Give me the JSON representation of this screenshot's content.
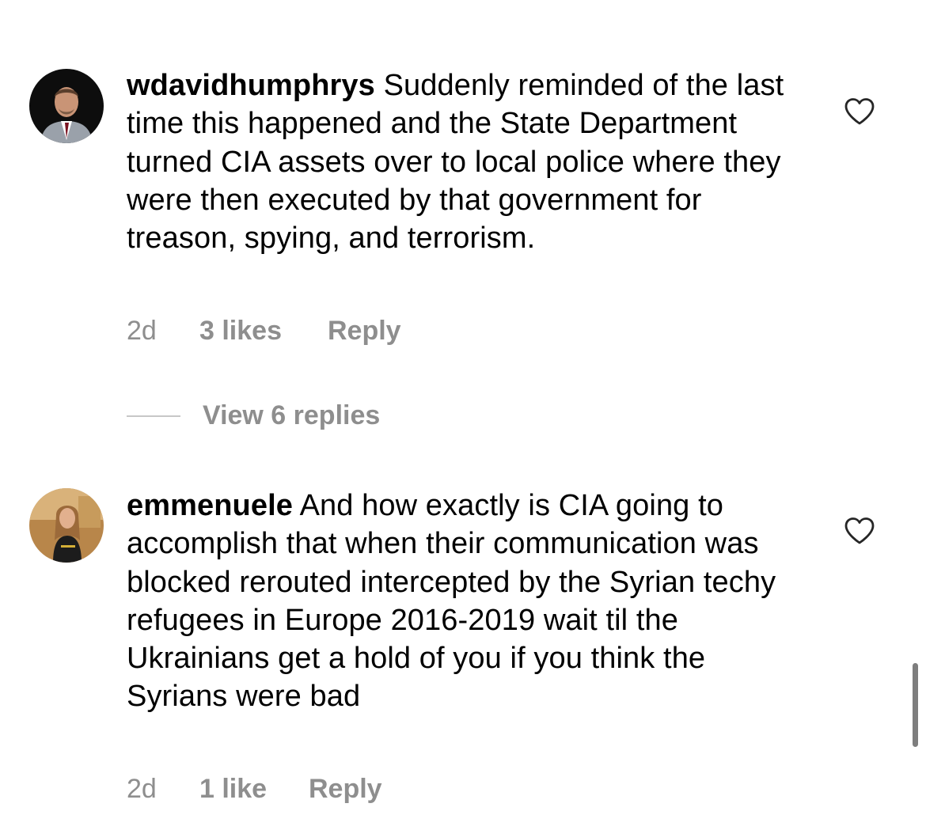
{
  "comments": [
    {
      "username": "wdavidhumphrys",
      "text": "Suddenly reminded of the last time this happened and the State Department turned CIA assets over to local police where they were then executed by that government for treason, spying, and terrorism.",
      "time": "2d",
      "likes": "3 likes",
      "reply": "Reply",
      "like_icon": "heart-outline-icon"
    },
    {
      "username": "emmenuele",
      "text": "And how exactly is CIA going to accomplish that when their communication was blocked rerouted intercepted by the Syrian techy refugees in Europe 2016-2019 wait til the Ukrainians get a hold of you if you think the Syrians were bad",
      "time": "2d",
      "likes": "1 like",
      "reply": "Reply",
      "like_icon": "heart-outline-icon"
    }
  ],
  "view_replies": "View 6 replies",
  "colors": {
    "text": "#000000",
    "meta": "#8e8e8e",
    "divider": "#c7c7c7",
    "scrollbar": "#7e7e7e"
  }
}
